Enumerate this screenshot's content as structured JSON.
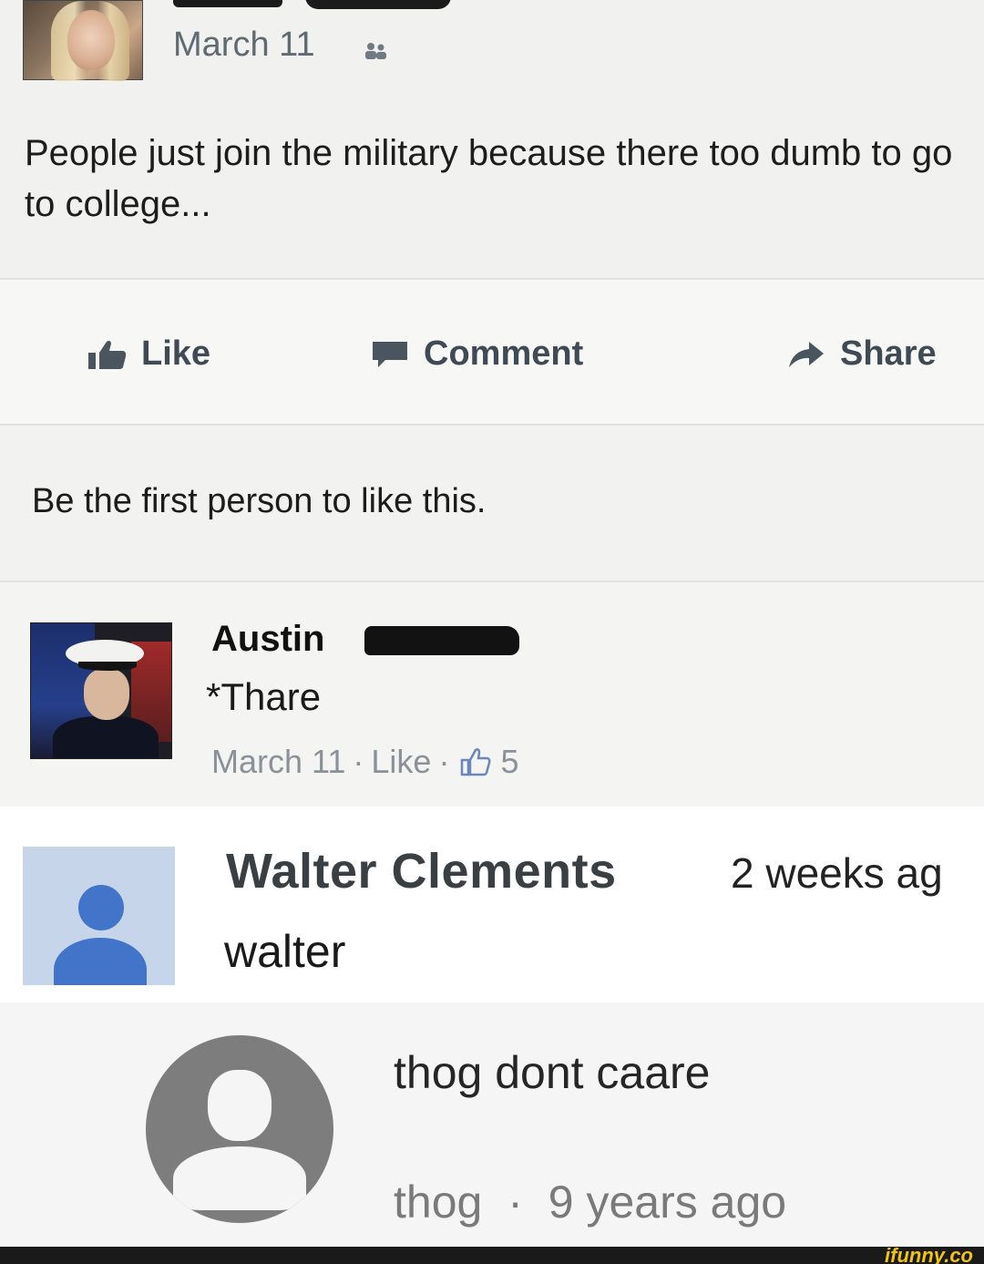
{
  "post": {
    "date": "March 11",
    "audience_icon": "friends-icon",
    "text": "People just join the military because there too dumb to go to college..."
  },
  "actions": {
    "like_label": "Like",
    "comment_label": "Comment",
    "share_label": "Share",
    "like_icon": "thumbs-up-icon",
    "comment_icon": "speech-bubble-icon",
    "share_icon": "share-arrow-icon"
  },
  "first_like": "Be the first person to like this.",
  "comment": {
    "author": "Austin",
    "body": "*Thare",
    "date": "March 11",
    "separator": "·",
    "like_label": "Like",
    "like_count": "5"
  },
  "yt_comment": {
    "author": "Walter Clements",
    "time": "2 weeks ag",
    "body": "walter"
  },
  "thog": {
    "body": "thog dont caare",
    "author": "thog",
    "separator": "·",
    "time": "9 years ago"
  },
  "watermark": "ifunny.co",
  "colors": {
    "muted_gray": "#8b9198",
    "action_text": "#3f4a55",
    "yt_avatar_blue": "#4274c9",
    "watermark_yellow": "#f1c40f"
  }
}
